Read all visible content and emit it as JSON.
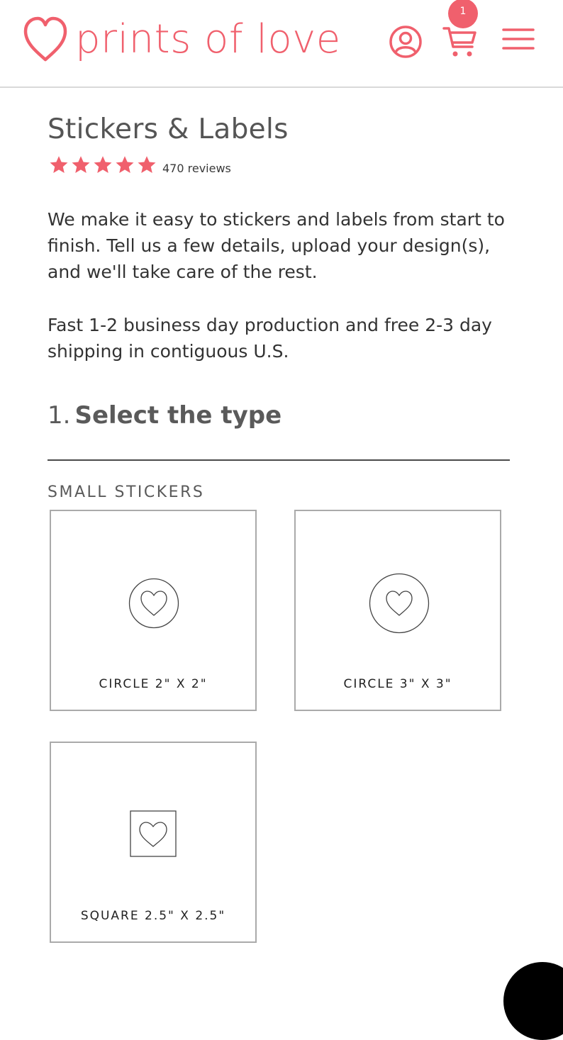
{
  "header": {
    "brand": "prints of love",
    "cart_count": "1",
    "colors": {
      "brand": "#f0606d",
      "header_border": "#d9d9d9"
    },
    "icons": [
      "heart-logo-icon",
      "account-icon",
      "cart-icon",
      "menu-icon"
    ]
  },
  "product": {
    "title": "Stickers & Labels",
    "rating": 5,
    "rating_max": 5,
    "reviews_label": "470 reviews",
    "star_color": "#f0606d"
  },
  "description": [
    "We make it easy to stickers and labels from start to finish. Tell us a few details, upload your design(s), and we'll take care of the rest.",
    "Fast 1-2 business day production and free 2-3 day shipping in contiguous U.S."
  ],
  "step": {
    "number": "1.",
    "title": "Select the type"
  },
  "section": {
    "label": "SMALL STICKERS",
    "options": [
      {
        "label": "CIRCLE 2\" X 2\"",
        "icon": "circle-heart-icon"
      },
      {
        "label": "CIRCLE 3\" X 3\"",
        "icon": "circle-heart-icon"
      },
      {
        "label": "SQUARE 2.5\" X 2.5\"",
        "icon": "square-heart-icon"
      }
    ]
  }
}
